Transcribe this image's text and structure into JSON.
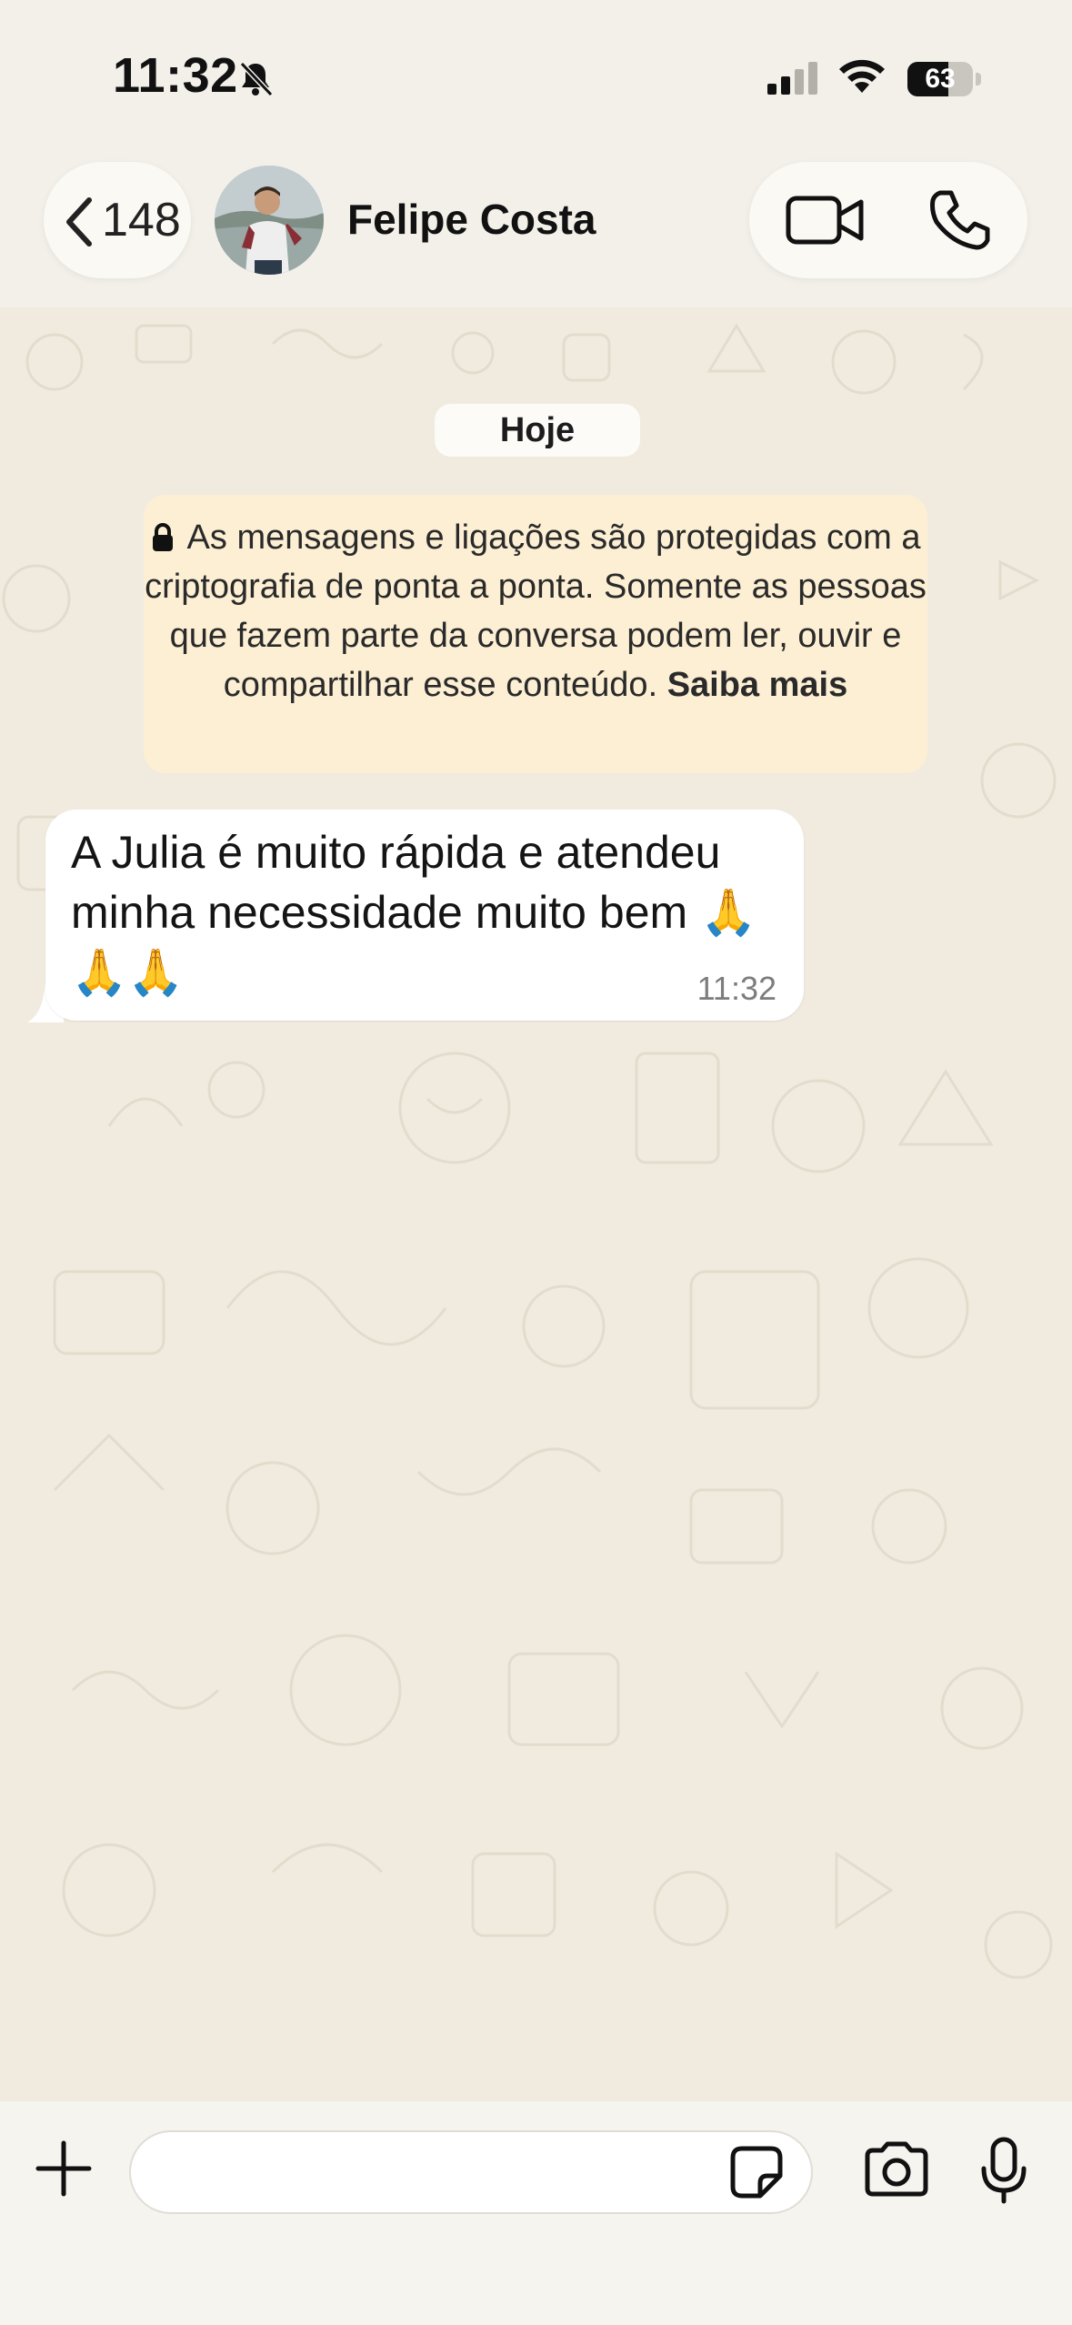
{
  "status_bar": {
    "time": "11:32",
    "battery": "63"
  },
  "header": {
    "back_count": "148",
    "contact_name": "Felipe Costa"
  },
  "chat": {
    "date_chip": "Hoje",
    "encryption_notice": {
      "text": "As mensagens e ligações são protegidas com a criptografia de ponta a ponta. Somente as pessoas que fazem parte da conversa podem ler, ouvir e compartilhar esse conteúdo.",
      "link": "Saiba mais"
    },
    "messages": [
      {
        "text": "A Julia é muito rápida e atendeu minha necessidade muito bem 🙏🙏🙏",
        "time": "11:32"
      }
    ]
  },
  "composer": {
    "placeholder": ""
  },
  "colors": {
    "chat_bg": "#f1ebdf",
    "notice_bg": "#fcefd3",
    "bubble_bg": "#ffffff"
  }
}
